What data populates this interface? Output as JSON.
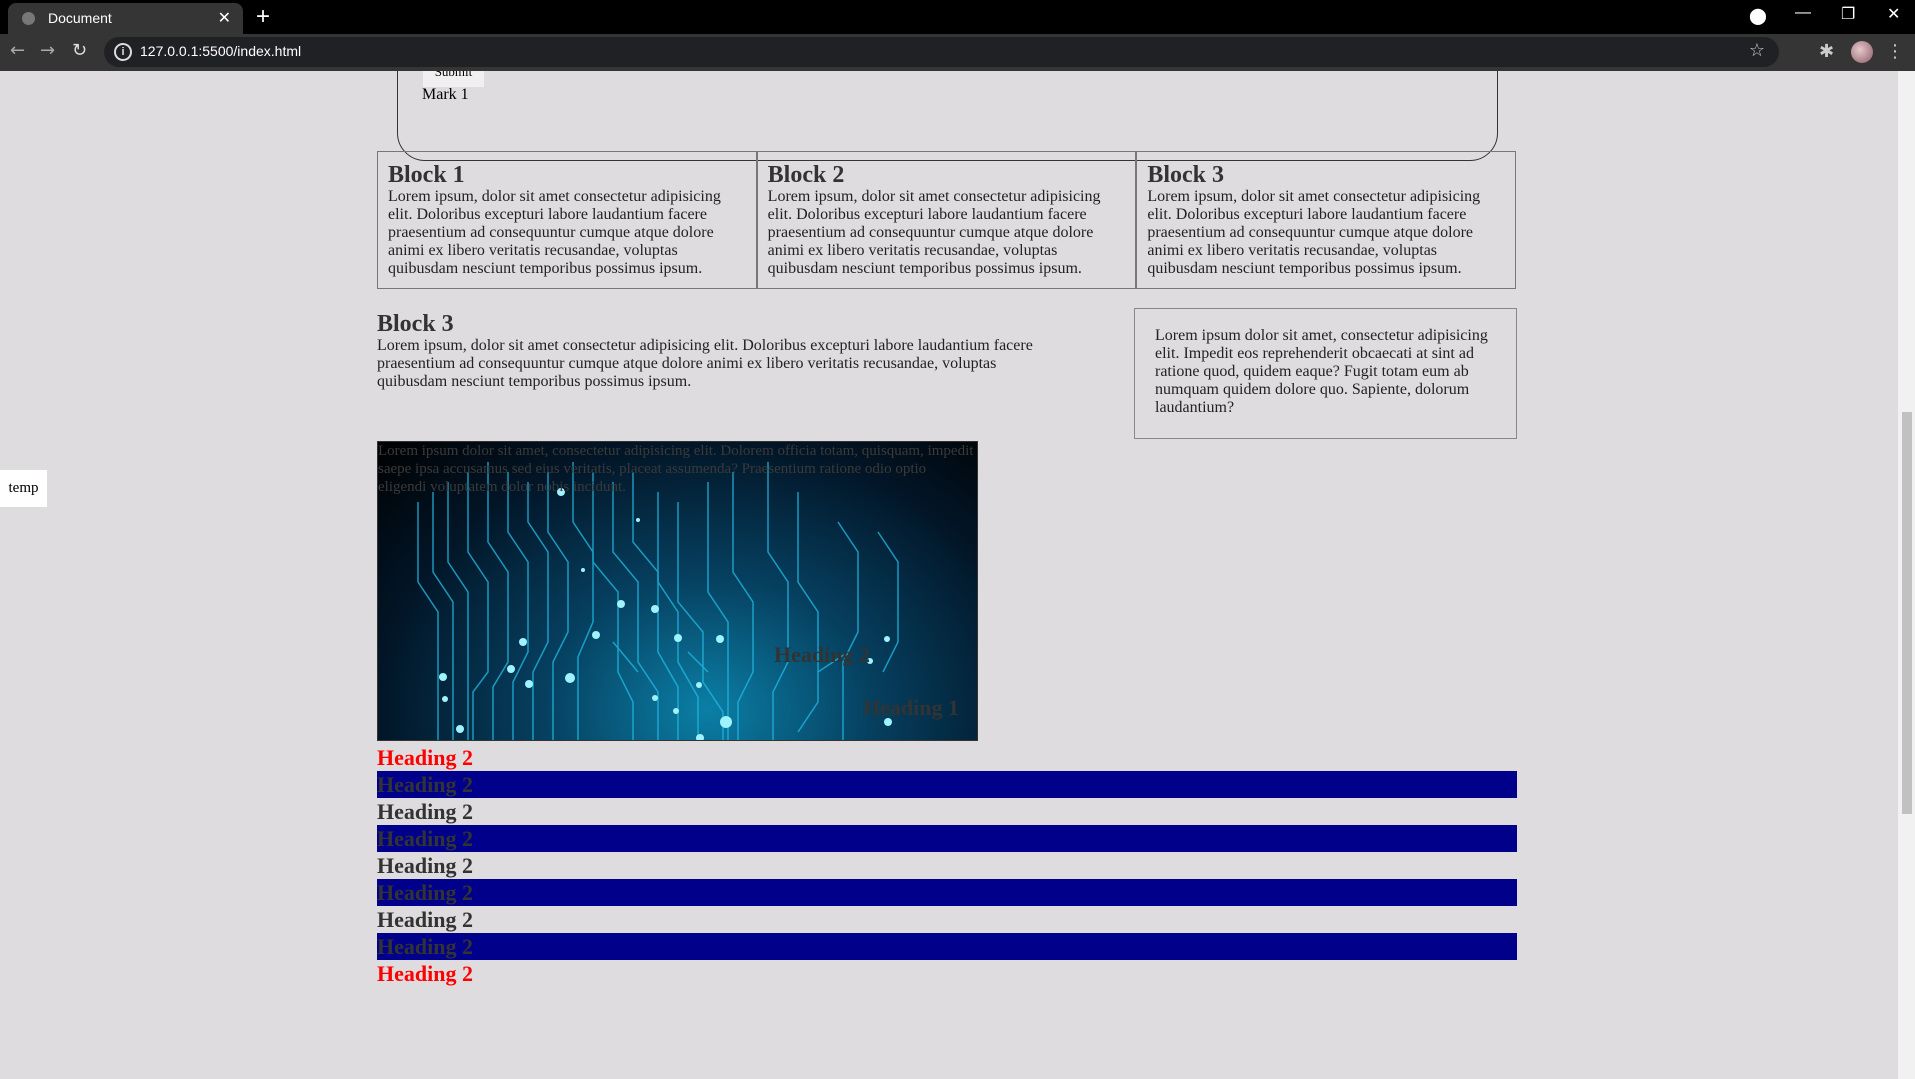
{
  "browser": {
    "tab_title": "Document",
    "url": "127.0.0.1:5500/index.html"
  },
  "page": {
    "form": {
      "submit_label": "Submit",
      "mark_label": "Mark 1"
    },
    "blocks": [
      {
        "title": "Block 1",
        "text": "Lorem ipsum, dolor sit amet consectetur adipisicing elit. Doloribus excepturi labore laudantium facere praesentium ad consequuntur cumque atque dolore animi ex libero veritatis recusandae, voluptas quibusdam nesciunt temporibus possimus ipsum."
      },
      {
        "title": "Block 2",
        "text": "Lorem ipsum, dolor sit amet consectetur adipisicing elit. Doloribus excepturi labore laudantium facere praesentium ad consequuntur cumque atque dolore animi ex libero veritatis recusandae, voluptas quibusdam nesciunt temporibus possimus ipsum."
      },
      {
        "title": "Block 3",
        "text": "Lorem ipsum, dolor sit amet consectetur adipisicing elit. Doloribus excepturi labore laudantium facere praesentium ad consequuntur cumque atque dolore animi ex libero veritatis recusandae, voluptas quibusdam nesciunt temporibus possimus ipsum."
      }
    ],
    "wide_block": {
      "title": "Block 3",
      "text": "Lorem ipsum, dolor sit amet consectetur adipisicing elit. Doloribus excepturi labore laudantium facere praesentium ad consequuntur cumque atque dolore animi ex libero veritatis recusandae, voluptas quibusdam nesciunt temporibus possimus ipsum."
    },
    "aside_text": "Lorem ipsum dolor sit amet, consectetur adipisicing elit. Impedit eos reprehenderit obcaecati at sint ad ratione quod, quidem eaque? Fugit totam eum ab numquam quidem dolore quo. Sapiente, dolorum laudantium?",
    "temp_label": "temp",
    "hero": {
      "text": "Lorem ipsum dolor sit amet, consectetur adipisicing elit. Dolorem officia totam, quisquam, impedit saepe ipsa accusamus sed eius veritatis, placeat assumenda? Praesentium ratione odio optio eligendi voluptatem dolor nobis incidunt.",
      "heading_2": "Heading 2",
      "heading_1": "Heading 1"
    },
    "headings": [
      {
        "text": "Heading 2",
        "style": "red"
      },
      {
        "text": "Heading 2",
        "style": "blue"
      },
      {
        "text": "Heading 2",
        "style": "plain"
      },
      {
        "text": "Heading 2",
        "style": "blue"
      },
      {
        "text": "Heading 2",
        "style": "plain"
      },
      {
        "text": "Heading 2",
        "style": "blue"
      },
      {
        "text": "Heading 2",
        "style": "plain"
      },
      {
        "text": "Heading 2",
        "style": "blue"
      },
      {
        "text": "Heading 2",
        "style": "red"
      }
    ]
  },
  "colors": {
    "page_bg": "#dedcde",
    "heading_red": "#ff0000",
    "band_blue": "#00008b"
  }
}
